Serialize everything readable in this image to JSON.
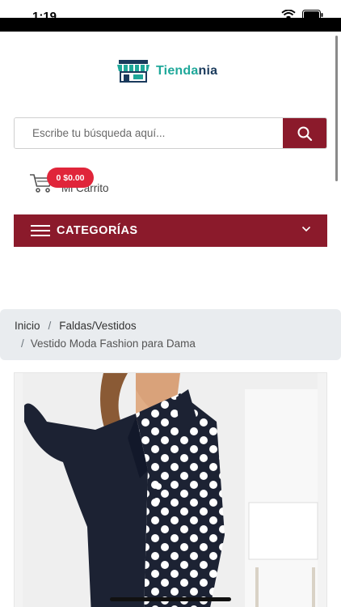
{
  "status_bar": {
    "time": "1:19"
  },
  "brand": {
    "part1": "Tienda",
    "part2": "nia"
  },
  "search": {
    "placeholder": "Escribe tu búsqueda aquí..."
  },
  "cart": {
    "badge": "0 $0.00",
    "label": "Mi Carrito"
  },
  "categories": {
    "label": "CATEGORÍAS"
  },
  "breadcrumb": {
    "home": "Inicio",
    "separator": "/",
    "category": "Faldas/Vestidos",
    "product": "Vestido Moda Fashion para Dama"
  },
  "colors": {
    "accent": "#8b1a2b",
    "badge": "#e0253a",
    "brand_teal": "#1fa89a",
    "brand_navy": "#1a3a5c",
    "breadcrumb_bg": "#e9ecef"
  },
  "icons": [
    "store-logo-icon",
    "search-icon",
    "cart-icon",
    "hamburger-icon",
    "chevron-down-icon",
    "wifi-icon",
    "battery-icon"
  ]
}
